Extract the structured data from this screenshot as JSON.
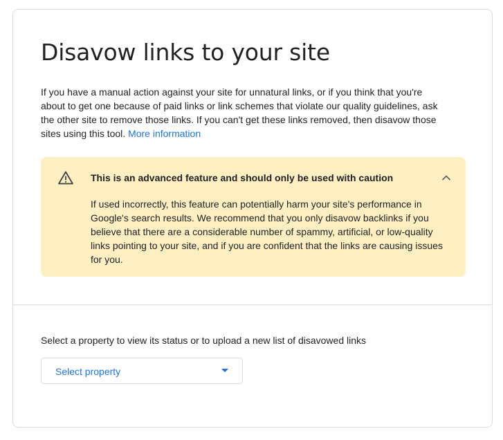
{
  "page": {
    "title": "Disavow links to your site",
    "intro_text": "If you have a manual action against your site for unnatural links, or if you think that you're about to get one because of paid links or link schemes that violate our quality guidelines, ask the other site to remove those links. If you can't get these links removed, then disavow those sites using this tool.",
    "more_info_link": "More information"
  },
  "warning": {
    "icon": "warning-triangle-icon",
    "title": "This is an advanced feature and should only be used with caution",
    "collapse_icon": "chevron-up-icon",
    "body": "If used incorrectly, this feature can potentially harm your site's performance in Google's search results. We recommend that you only disavow backlinks if you believe that there are a considerable number of spammy, artificial, or low-quality links pointing to your site, and if you are confident that the links are causing issues for you.",
    "background_color": "#feefc3"
  },
  "property": {
    "prompt": "Select a property to view its status or to upload a new list of disavowed links",
    "select_value": "Select property",
    "dropdown_icon": "caret-down-icon"
  },
  "colors": {
    "accent": "#1a73e8",
    "text": "#202124",
    "border": "#dadce0"
  }
}
